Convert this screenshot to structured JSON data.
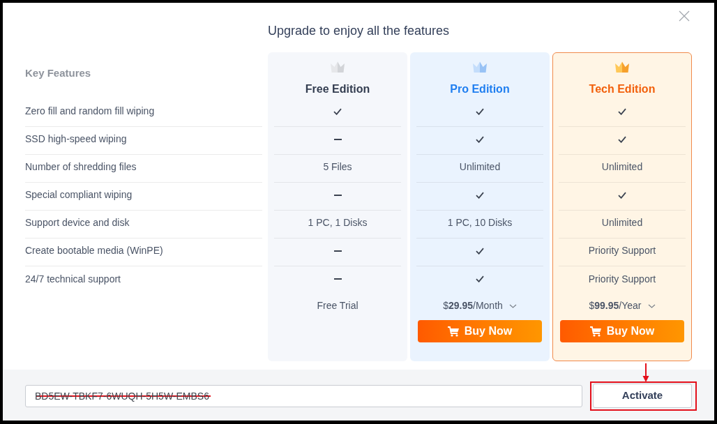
{
  "dialog": {
    "title": "Upgrade to enjoy all the features"
  },
  "features": {
    "heading": "Key Features",
    "rows": [
      "Zero fill and random fill wiping",
      "SSD high-speed wiping",
      "Number of shredding files",
      "Special compliant wiping",
      "Support device and disk",
      "Create bootable media (WinPE)",
      "24/7 technical support"
    ]
  },
  "plans": [
    {
      "kind": "free",
      "name": "Free Edition",
      "selected": false,
      "cells": [
        {
          "kind": "yes"
        },
        {
          "kind": "no"
        },
        {
          "kind": "text",
          "text": "5 Files"
        },
        {
          "kind": "no"
        },
        {
          "kind": "text",
          "text": "1 PC, 1 Disks"
        },
        {
          "kind": "no"
        },
        {
          "kind": "no"
        }
      ],
      "price": "Free Trial",
      "price_menu": false
    },
    {
      "kind": "pro",
      "name": "Pro Edition",
      "selected": false,
      "cells": [
        {
          "kind": "yes"
        },
        {
          "kind": "yes"
        },
        {
          "kind": "text",
          "text": "Unlimited"
        },
        {
          "kind": "yes"
        },
        {
          "kind": "text",
          "text": "1 PC, 10 Disks"
        },
        {
          "kind": "yes"
        },
        {
          "kind": "yes"
        }
      ],
      "price": "$**29.95**/Month",
      "price_menu": true,
      "buy_button": "Buy Now"
    },
    {
      "kind": "tech",
      "name": "Tech Edition",
      "selected": true,
      "cells": [
        {
          "kind": "yes"
        },
        {
          "kind": "yes"
        },
        {
          "kind": "text",
          "text": "Unlimited"
        },
        {
          "kind": "yes"
        },
        {
          "kind": "text",
          "text": "Unlimited"
        },
        {
          "kind": "text",
          "text": "Priority Support"
        },
        {
          "kind": "text",
          "text": "Priority Support"
        }
      ],
      "price": "$**99.95**/Year",
      "price_menu": true,
      "buy_button": "Buy Now"
    }
  ],
  "license": {
    "value": "BD5EW-TBKF7-6WUQH-5H5W-EMBS6",
    "struck_out": true
  },
  "activate_button": {
    "label": "Activate",
    "highlighted": true
  }
}
